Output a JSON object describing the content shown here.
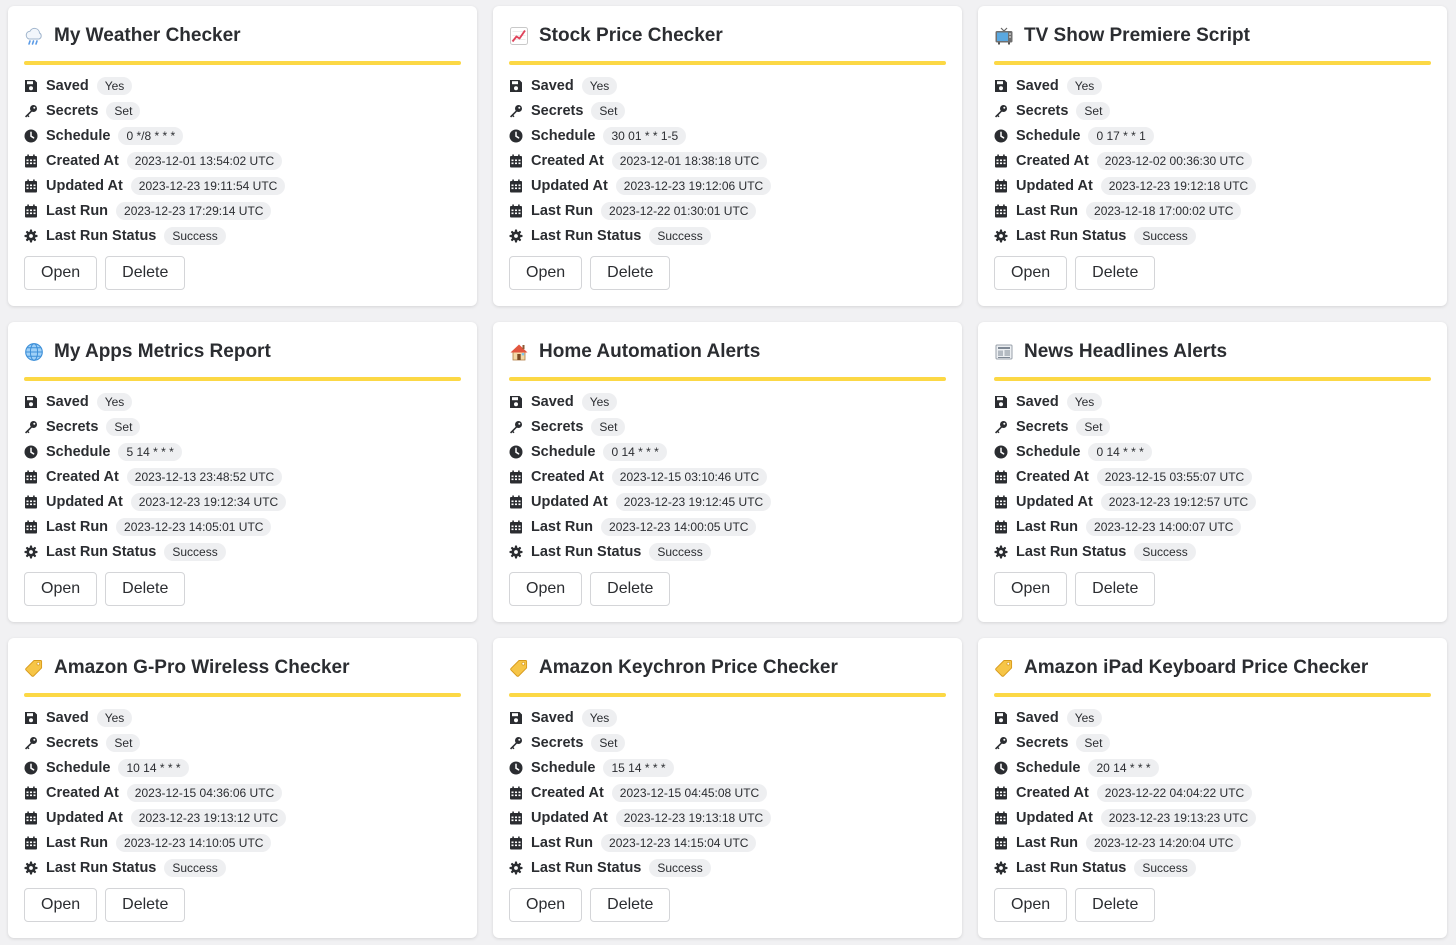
{
  "labels": {
    "saved": "Saved",
    "secrets": "Secrets",
    "schedule": "Schedule",
    "created_at": "Created At",
    "updated_at": "Updated At",
    "last_run": "Last Run",
    "last_run_status": "Last Run Status",
    "open": "Open",
    "delete": "Delete"
  },
  "colors": {
    "accent": "#fcd845",
    "pill_bg": "#eeeff1",
    "background": "#f1f1f3"
  },
  "cards": [
    {
      "title": "My Weather Checker",
      "icon": "weather-cloud-icon",
      "saved": "Yes",
      "secrets": "Set",
      "schedule": "0 */8 * * *",
      "created_at": "2023-12-01 13:54:02 UTC",
      "updated_at": "2023-12-23 19:11:54 UTC",
      "last_run": "2023-12-23 17:29:14 UTC",
      "last_run_status": "Success"
    },
    {
      "title": "Stock Price Checker",
      "icon": "chart-up-icon",
      "saved": "Yes",
      "secrets": "Set",
      "schedule": "30 01 * * 1-5",
      "created_at": "2023-12-01 18:38:18 UTC",
      "updated_at": "2023-12-23 19:12:06 UTC",
      "last_run": "2023-12-22 01:30:01 UTC",
      "last_run_status": "Success"
    },
    {
      "title": "TV Show Premiere Script",
      "icon": "tv-icon",
      "saved": "Yes",
      "secrets": "Set",
      "schedule": "0 17 * * 1",
      "created_at": "2023-12-02 00:36:30 UTC",
      "updated_at": "2023-12-23 19:12:18 UTC",
      "last_run": "2023-12-18 17:00:02 UTC",
      "last_run_status": "Success"
    },
    {
      "title": "My Apps Metrics Report",
      "icon": "globe-icon",
      "saved": "Yes",
      "secrets": "Set",
      "schedule": "5 14 * * *",
      "created_at": "2023-12-13 23:48:52 UTC",
      "updated_at": "2023-12-23 19:12:34 UTC",
      "last_run": "2023-12-23 14:05:01 UTC",
      "last_run_status": "Success"
    },
    {
      "title": "Home Automation Alerts",
      "icon": "house-icon",
      "saved": "Yes",
      "secrets": "Set",
      "schedule": "0 14 * * *",
      "created_at": "2023-12-15 03:10:46 UTC",
      "updated_at": "2023-12-23 19:12:45 UTC",
      "last_run": "2023-12-23 14:00:05 UTC",
      "last_run_status": "Success"
    },
    {
      "title": "News Headlines Alerts",
      "icon": "newspaper-icon",
      "saved": "Yes",
      "secrets": "Set",
      "schedule": "0 14 * * *",
      "created_at": "2023-12-15 03:55:07 UTC",
      "updated_at": "2023-12-23 19:12:57 UTC",
      "last_run": "2023-12-23 14:00:07 UTC",
      "last_run_status": "Success"
    },
    {
      "title": "Amazon G-Pro Wireless Checker",
      "icon": "price-tag-icon",
      "saved": "Yes",
      "secrets": "Set",
      "schedule": "10 14 * * *",
      "created_at": "2023-12-15 04:36:06 UTC",
      "updated_at": "2023-12-23 19:13:12 UTC",
      "last_run": "2023-12-23 14:10:05 UTC",
      "last_run_status": "Success"
    },
    {
      "title": "Amazon Keychron Price Checker",
      "icon": "price-tag-icon",
      "saved": "Yes",
      "secrets": "Set",
      "schedule": "15 14 * * *",
      "created_at": "2023-12-15 04:45:08 UTC",
      "updated_at": "2023-12-23 19:13:18 UTC",
      "last_run": "2023-12-23 14:15:04 UTC",
      "last_run_status": "Success"
    },
    {
      "title": "Amazon iPad Keyboard Price Checker",
      "icon": "price-tag-icon",
      "saved": "Yes",
      "secrets": "Set",
      "schedule": "20 14 * * *",
      "created_at": "2023-12-22 04:04:22 UTC",
      "updated_at": "2023-12-23 19:13:23 UTC",
      "last_run": "2023-12-23 14:20:04 UTC",
      "last_run_status": "Success"
    }
  ]
}
